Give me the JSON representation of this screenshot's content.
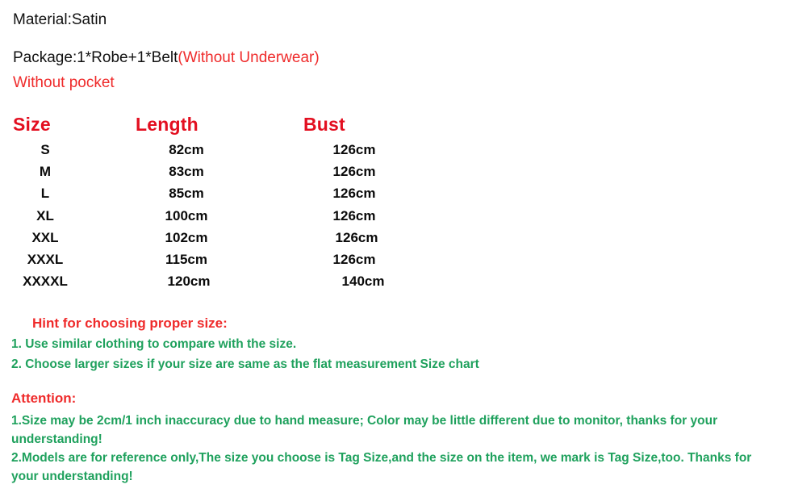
{
  "colors": {
    "red": "#ef2b2b",
    "header_red": "#e30f20",
    "green": "#1fa15d",
    "black": "#0a0a0a",
    "background": "#ffffff"
  },
  "intro": {
    "material": "Material:Satin",
    "package_black": "Package:1*Robe+1*Belt",
    "package_red": "(Without Underwear)",
    "pocket": "Without pocket"
  },
  "size_chart": {
    "headers": [
      "Size",
      "Length",
      "Bust"
    ],
    "rows": [
      {
        "size": "S",
        "length": "82cm",
        "bust": "126cm"
      },
      {
        "size": "M",
        "length": "83cm",
        "bust": "126cm"
      },
      {
        "size": "L",
        "length": "85cm",
        "bust": "126cm"
      },
      {
        "size": "XL",
        "length": "100cm",
        "bust": "126cm"
      },
      {
        "size": "XXL",
        "length": "102cm",
        "bust": "126cm"
      },
      {
        "size": "XXXL",
        "length": "115cm",
        "bust": "126cm"
      },
      {
        "size": "XXXXL",
        "length": "120cm",
        "bust": "140cm"
      }
    ]
  },
  "hint": {
    "title": "Hint for choosing proper size:",
    "items": [
      "1. Use similar clothing to compare with the size.",
      "2. Choose larger sizes if your size are same as the flat measurement Size chart"
    ]
  },
  "attention": {
    "title": "Attention:",
    "items": [
      "1.Size may be 2cm/1 inch inaccuracy due to hand measure; Color may be little different   due to monitor, thanks for your understanding!",
      "2.Models are for reference only,The size you choose is Tag Size,and the size on the item,  we mark is Tag Size,too. Thanks for your understanding!"
    ]
  }
}
